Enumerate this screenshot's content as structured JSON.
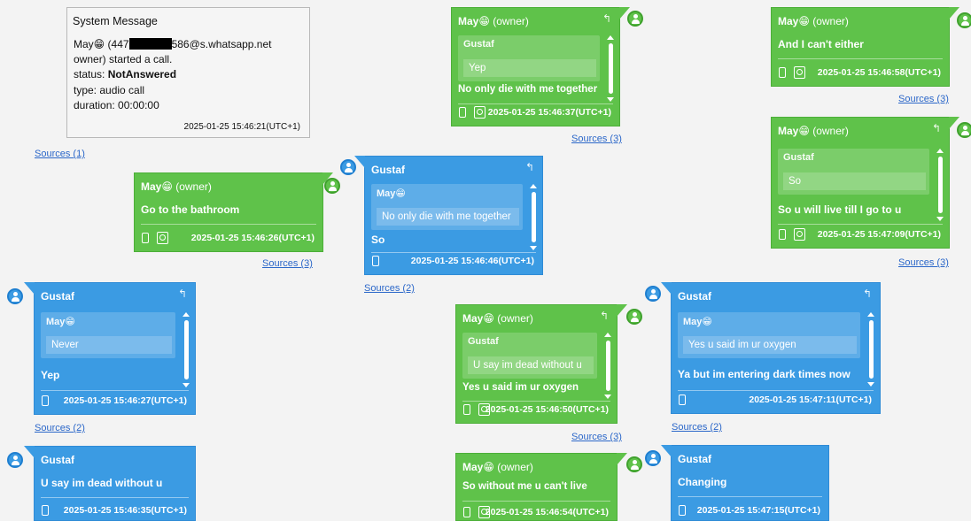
{
  "emoji": "😁",
  "system_message": {
    "title": "System Message",
    "line1_prefix": "May",
    "line1_a": "(447",
    "line1_b": "586@s.whatsapp.net",
    "line2": "owner) started a call.",
    "status_label": "status:",
    "status_value": "NotAnswered",
    "type_label": "type:",
    "type_value": "audio call",
    "duration_label": "duration:",
    "duration_value": "00:00:00",
    "timestamp": "2025-01-25 15:46:21(UTC+1)",
    "sources": "Sources (1)"
  },
  "messages": [
    {
      "id": "m1",
      "sender": "May😁",
      "role": "(owner)",
      "body": "Go to the bathroom",
      "timestamp": "2025-01-25 15:46:26(UTC+1)",
      "sources": "Sources (3)"
    },
    {
      "id": "m2",
      "sender": "Gustaf",
      "quote_sender": "May😁",
      "quote_text": "No only die with me together",
      "body": "So",
      "timestamp": "2025-01-25 15:46:46(UTC+1)",
      "sources": "Sources (2)"
    },
    {
      "id": "m3",
      "sender": "May😁",
      "role": "(owner)",
      "quote_sender": "Gustaf",
      "quote_text": "Yep",
      "body": "No only die with me together",
      "timestamp": "2025-01-25 15:46:37(UTC+1)",
      "sources": "Sources (3)"
    },
    {
      "id": "m4",
      "sender": "May😁",
      "role": "(owner)",
      "body": "And I can't either",
      "timestamp": "2025-01-25 15:46:58(UTC+1)",
      "sources": "Sources (3)"
    },
    {
      "id": "m5",
      "sender": "May😁",
      "role": "(owner)",
      "quote_sender": "Gustaf",
      "quote_text": "So",
      "body": "So u will live till I go to u",
      "timestamp": "2025-01-25 15:47:09(UTC+1)",
      "sources": "Sources (3)"
    },
    {
      "id": "m6",
      "sender": "Gustaf",
      "quote_sender": "May😁",
      "quote_text": "Never",
      "body": "Yep",
      "timestamp": "2025-01-25 15:46:27(UTC+1)",
      "sources": "Sources (2)"
    },
    {
      "id": "m7",
      "sender": "May😁",
      "role": "(owner)",
      "quote_sender": "Gustaf",
      "quote_text": "U say im dead without u",
      "body": "Yes u said im ur oxygen",
      "timestamp": "2025-01-25 15:46:50(UTC+1)",
      "sources": "Sources (3)"
    },
    {
      "id": "m8",
      "sender": "Gustaf",
      "quote_sender": "May😁",
      "quote_text": "Yes u said im ur oxygen",
      "body": "Ya but im entering dark times now",
      "timestamp": "2025-01-25 15:47:11(UTC+1)",
      "sources": "Sources (2)"
    },
    {
      "id": "m9",
      "sender": "Gustaf",
      "body": "U say im dead without u",
      "timestamp": "2025-01-25 15:46:35(UTC+1)"
    },
    {
      "id": "m10",
      "sender": "May😁",
      "role": "(owner)",
      "body": "So without me u can't live",
      "timestamp": "2025-01-25 15:46:54(UTC+1)"
    },
    {
      "id": "m11",
      "sender": "Gustaf",
      "body": "Changing",
      "timestamp": "2025-01-25 15:47:15(UTC+1)"
    }
  ],
  "icons": {
    "reply": "reply-icon",
    "phone": "phone-icon",
    "contact": "contact-card-icon",
    "avatar": "user-avatar-icon"
  },
  "colors": {
    "owner_bubble": "#5fc24a",
    "other_bubble": "#3b9be3",
    "link": "#2b67c9"
  }
}
